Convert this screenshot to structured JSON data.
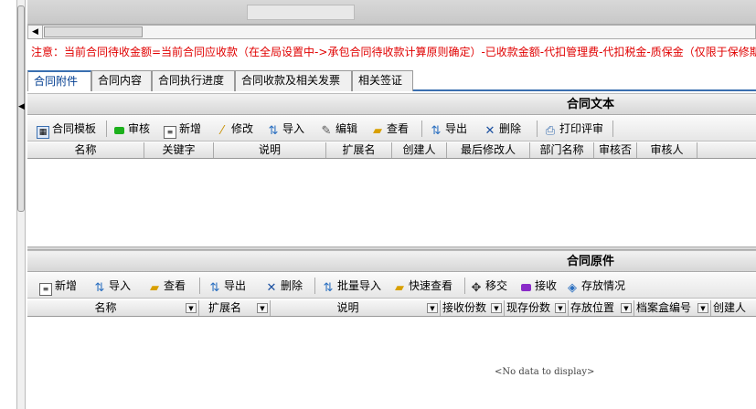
{
  "notice": "注意：当前合同待收金额=当前合同应收款（在全局设置中->承包合同待收款计算原则确定）-已收款金额-代扣管理费-代扣税金-质保金（仅限于保修期",
  "tabs": [
    {
      "label": "合同附件",
      "active": true
    },
    {
      "label": "合同内容",
      "active": false
    },
    {
      "label": "合同执行进度",
      "active": false
    },
    {
      "label": "合同收款及相关发票",
      "active": false
    },
    {
      "label": "相关签证",
      "active": false
    }
  ],
  "text_section": {
    "title": "合同文本",
    "toolbar": [
      {
        "label": "合同模板",
        "icon": "table-icon"
      },
      {
        "label": "审核",
        "icon": "green-dot-icon"
      },
      {
        "label": "新增",
        "icon": "document-icon"
      },
      {
        "label": "修改",
        "icon": "wand-icon"
      },
      {
        "label": "导入",
        "icon": "import-icon"
      },
      {
        "label": "编辑",
        "icon": "edit-icon"
      },
      {
        "label": "查看",
        "icon": "folder-open-icon"
      },
      {
        "label": "导出",
        "icon": "export-icon"
      },
      {
        "label": "删除",
        "icon": "delete-x-icon"
      },
      {
        "label": "打印评审",
        "icon": "printer-icon"
      }
    ],
    "columns": [
      "名称",
      "关键字",
      "说明",
      "扩展名",
      "创建人",
      "最后修改人",
      "部门名称",
      "审核否",
      "审核人"
    ]
  },
  "original_section": {
    "title": "合同原件",
    "toolbar": [
      {
        "label": "新增",
        "icon": "document-icon"
      },
      {
        "label": "导入",
        "icon": "import-icon"
      },
      {
        "label": "查看",
        "icon": "folder-open-icon"
      },
      {
        "label": "导出",
        "icon": "export-icon"
      },
      {
        "label": "删除",
        "icon": "delete-x-icon"
      },
      {
        "label": "批量导入",
        "icon": "import-icon"
      },
      {
        "label": "快速查看",
        "icon": "folder-open-icon"
      },
      {
        "label": "移交",
        "icon": "move-icon"
      },
      {
        "label": "接收",
        "icon": "purple-box-icon"
      },
      {
        "label": "存放情况",
        "icon": "diamond-icon"
      }
    ],
    "columns": [
      "名称",
      "扩展名",
      "说明",
      "接收份数",
      "现存份数",
      "存放位置",
      "档案盒编号",
      "创建人"
    ],
    "empty_text": "<No data to display>"
  }
}
